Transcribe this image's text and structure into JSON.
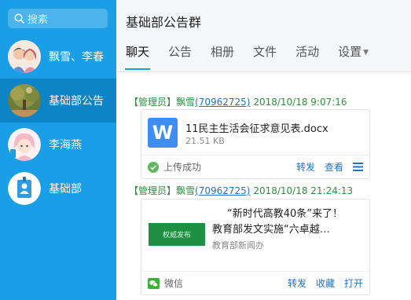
{
  "sidebar": {
    "search_placeholder": "搜索",
    "contacts": [
      {
        "name": "飘雪、李春",
        "avatar": "couple-avatar"
      },
      {
        "name": "基础部公告",
        "avatar": "tree-photo-avatar",
        "active": true
      },
      {
        "name": "李海燕",
        "avatar": "girl-avatar"
      },
      {
        "name": "基础部",
        "avatar": "badge-avatar"
      }
    ]
  },
  "header": {
    "title": "基础部公告群",
    "tabs": [
      "聊天",
      "公告",
      "相册",
      "文件",
      "活动",
      "设置"
    ],
    "active_tab": "聊天"
  },
  "messages": [
    {
      "role": "【管理员】",
      "sender": "飘雪",
      "qq": "(70962725)",
      "time": "2018/10/18 9:07:16",
      "file": {
        "name": "11民主生活会征求意见表.docx",
        "size": "21.51 KB",
        "icon": "word-doc-icon",
        "status": "上传成功",
        "actions": [
          "转发",
          "查看"
        ]
      }
    },
    {
      "role": "【管理员】",
      "sender": "飘雪",
      "qq": "(70962725)",
      "time": "2018/10/18 21:24:13",
      "article": {
        "title_line1": "“新时代高教40条”来了！",
        "title_line2": "教育部发文实施“六卓越…",
        "source": "教育部新闻办",
        "thumb_text": "权威发布",
        "app": "微信",
        "actions": [
          "转发",
          "收藏",
          "打开"
        ]
      }
    }
  ],
  "colors": {
    "sidebar": "#1a9ee6",
    "active_contact": "#0d84c6",
    "accent": "#1a9ee6",
    "meta_green": "#2f8f3f",
    "link_blue": "#2372c2"
  }
}
